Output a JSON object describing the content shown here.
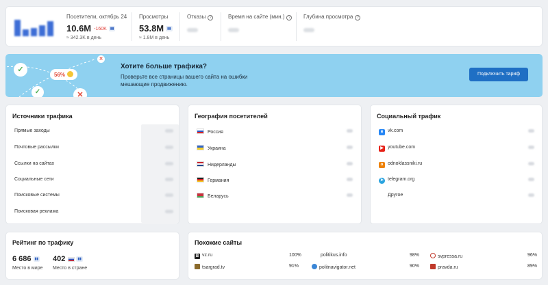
{
  "stats": {
    "visitors_label": "Посетители, октябрь 24",
    "visitors_value": "10.6M",
    "visitors_delta": "-160K",
    "visitors_per_day": "≈ 342.3K в день",
    "views_label": "Просмотры",
    "views_value": "53.8M",
    "views_per_day": "≈ 1.8M в день",
    "bounce_label": "Отказы",
    "time_label": "Время на сайте (мин.)",
    "depth_label": "Глубина просмотра"
  },
  "banner": {
    "title": "Хотите больше трафика?",
    "text": "Проверьте все страницы вашего сайта на ошибки мешающие продвижению.",
    "button": "Подключить тариф",
    "percent": "56%"
  },
  "traffic_sources": {
    "title": "Источники трафика",
    "items": [
      "Прямые заходы",
      "Почтовые рассылки",
      "Ссылки на сайтах",
      "Социальные сети",
      "Поисковые системы",
      "Поисковая реклама"
    ]
  },
  "geography": {
    "title": "География посетителей",
    "items": [
      "Россия",
      "Украина",
      "Нидерланды",
      "Германия",
      "Беларусь"
    ]
  },
  "social": {
    "title": "Социальный трафик",
    "items": [
      "vk.com",
      "youtube.com",
      "odnoklassniki.ru",
      "telegram.org",
      "Другое"
    ]
  },
  "rating": {
    "title": "Рейтинг по трафику",
    "world_value": "6 686",
    "world_label": "Место в мире",
    "country_value": "402",
    "country_label": "Место в стране"
  },
  "similar": {
    "title": "Похожие сайты",
    "sites": [
      {
        "name": "vz.ru",
        "pct": "100%"
      },
      {
        "name": "politikus.info",
        "pct": "98%"
      },
      {
        "name": "svpressa.ru",
        "pct": "96%"
      },
      {
        "name": "tsargrad.tv",
        "pct": "91%"
      },
      {
        "name": "politnavigator.net",
        "pct": "90%"
      },
      {
        "name": "pravda.ru",
        "pct": "89%"
      }
    ]
  },
  "colors": {
    "accent": "#1f6fc4",
    "banner_bg": "#8fd1f0",
    "negative": "#e0413a"
  }
}
